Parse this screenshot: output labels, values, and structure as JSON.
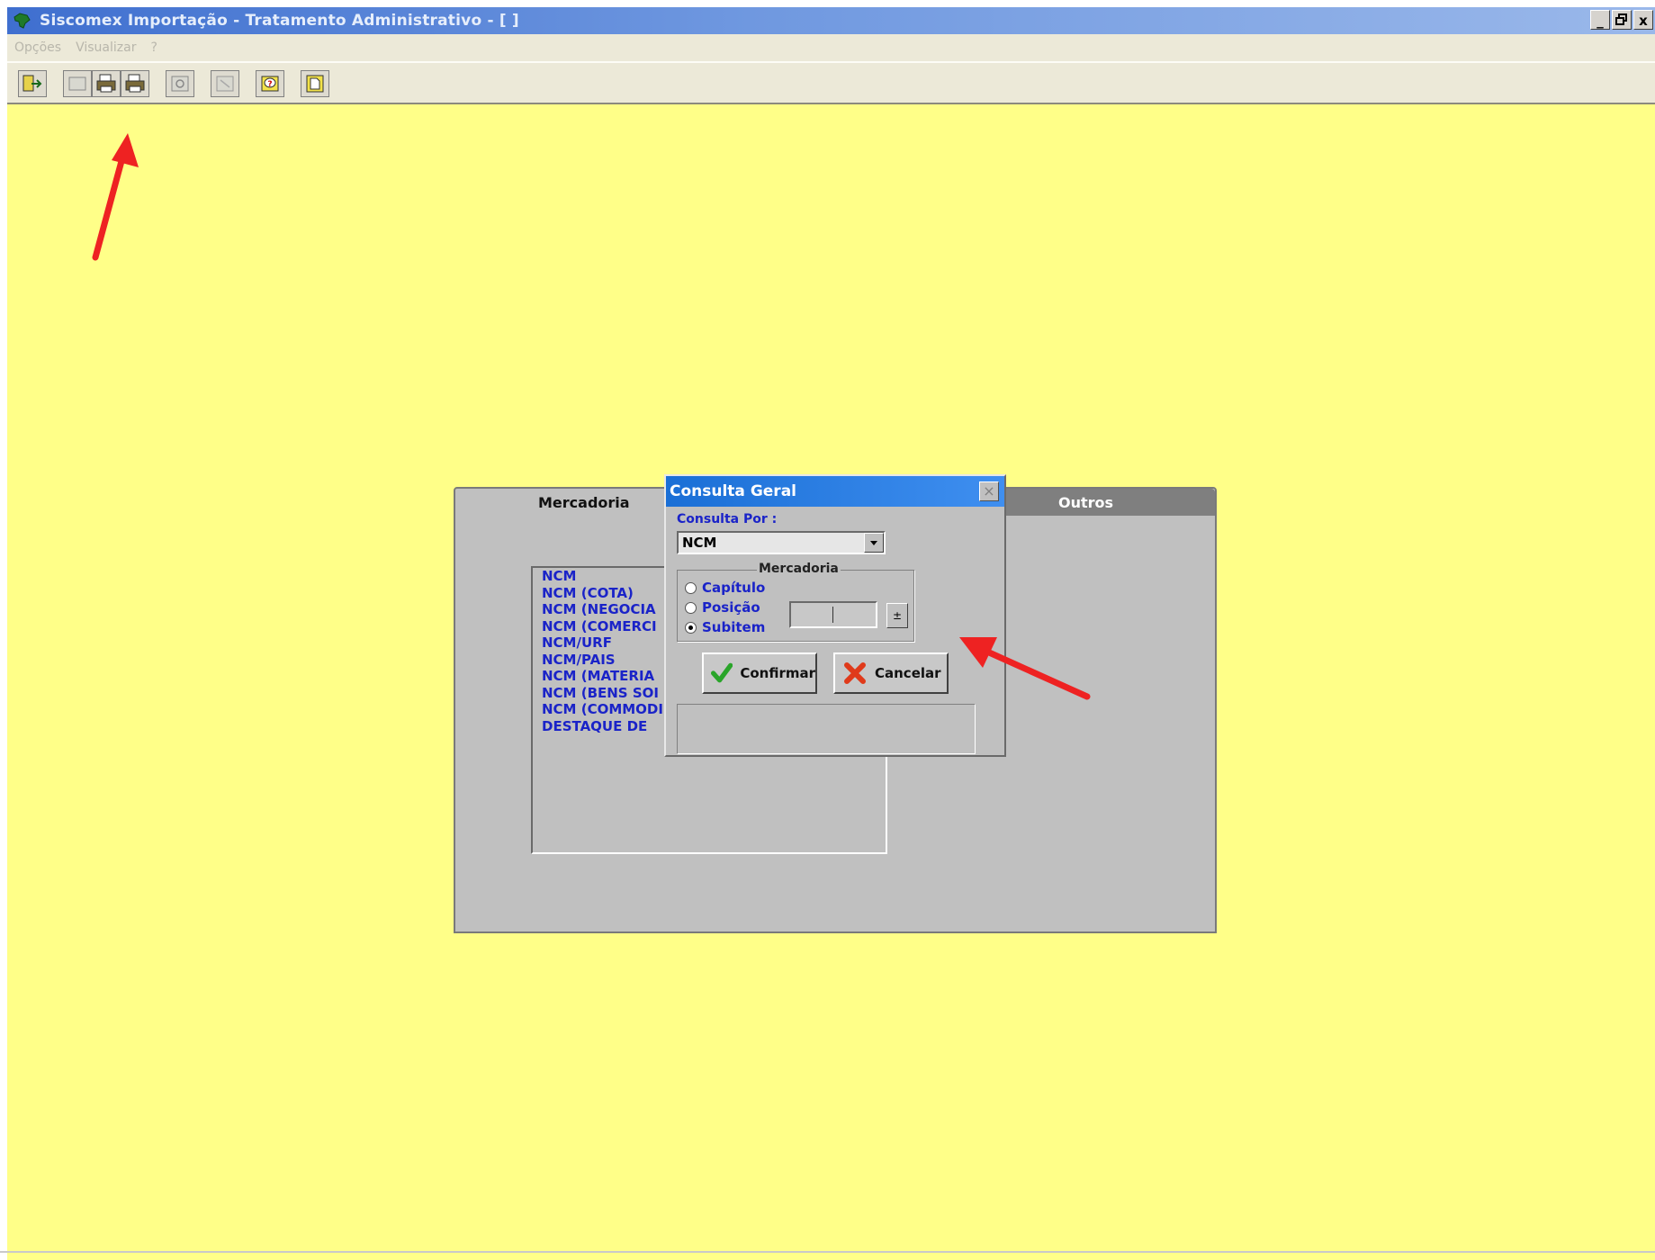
{
  "window": {
    "title": "Siscomex  Importação  -  Tratamento Administrativo - [ ]",
    "app_icon": "siscomex-brazil-map-icon",
    "controls": {
      "minimize": "_",
      "restore": "\u0019",
      "close": "x"
    }
  },
  "menu": {
    "items": [
      "Opções",
      "Visualizar",
      "?"
    ]
  },
  "toolbar": {
    "buttons": [
      "exit-icon",
      "blank-icon",
      "print-icon",
      "print-all-icon",
      "refresh-icon",
      "disabled-icon",
      "help-icon",
      "new-document-icon"
    ]
  },
  "panel": {
    "tab_mercadoria": "Mercadoria",
    "tab_outros": "Outros",
    "list_items": [
      "NCM",
      "NCM (COTA)",
      "NCM (NEGOCIA",
      "NCM (COMERCI",
      "NCM/URF",
      "NCM/PAIS",
      "NCM (MATERIA",
      "NCM (BENS SOI",
      "NCM (COMMODI",
      "DESTAQUE DE"
    ]
  },
  "dialog": {
    "title": "Consulta Geral",
    "close_glyph": "×",
    "consulta_por_label": "Consulta Por :",
    "consulta_por_value": "NCM",
    "group_title": "Mercadoria",
    "radios": [
      {
        "label": "Capítulo",
        "checked": false
      },
      {
        "label": "Posição",
        "checked": false
      },
      {
        "label": "Subitem",
        "checked": true
      }
    ],
    "spin_glyph": "±",
    "confirm_label": "Confirmar",
    "cancel_label": "Cancelar"
  },
  "colors": {
    "desktop": "#ffff88",
    "title_gradient_start": "#3f6fcf",
    "dialog_title": "#1a6fd6",
    "list_text": "#1a23c8",
    "annotation_arrow": "#ee2222"
  }
}
